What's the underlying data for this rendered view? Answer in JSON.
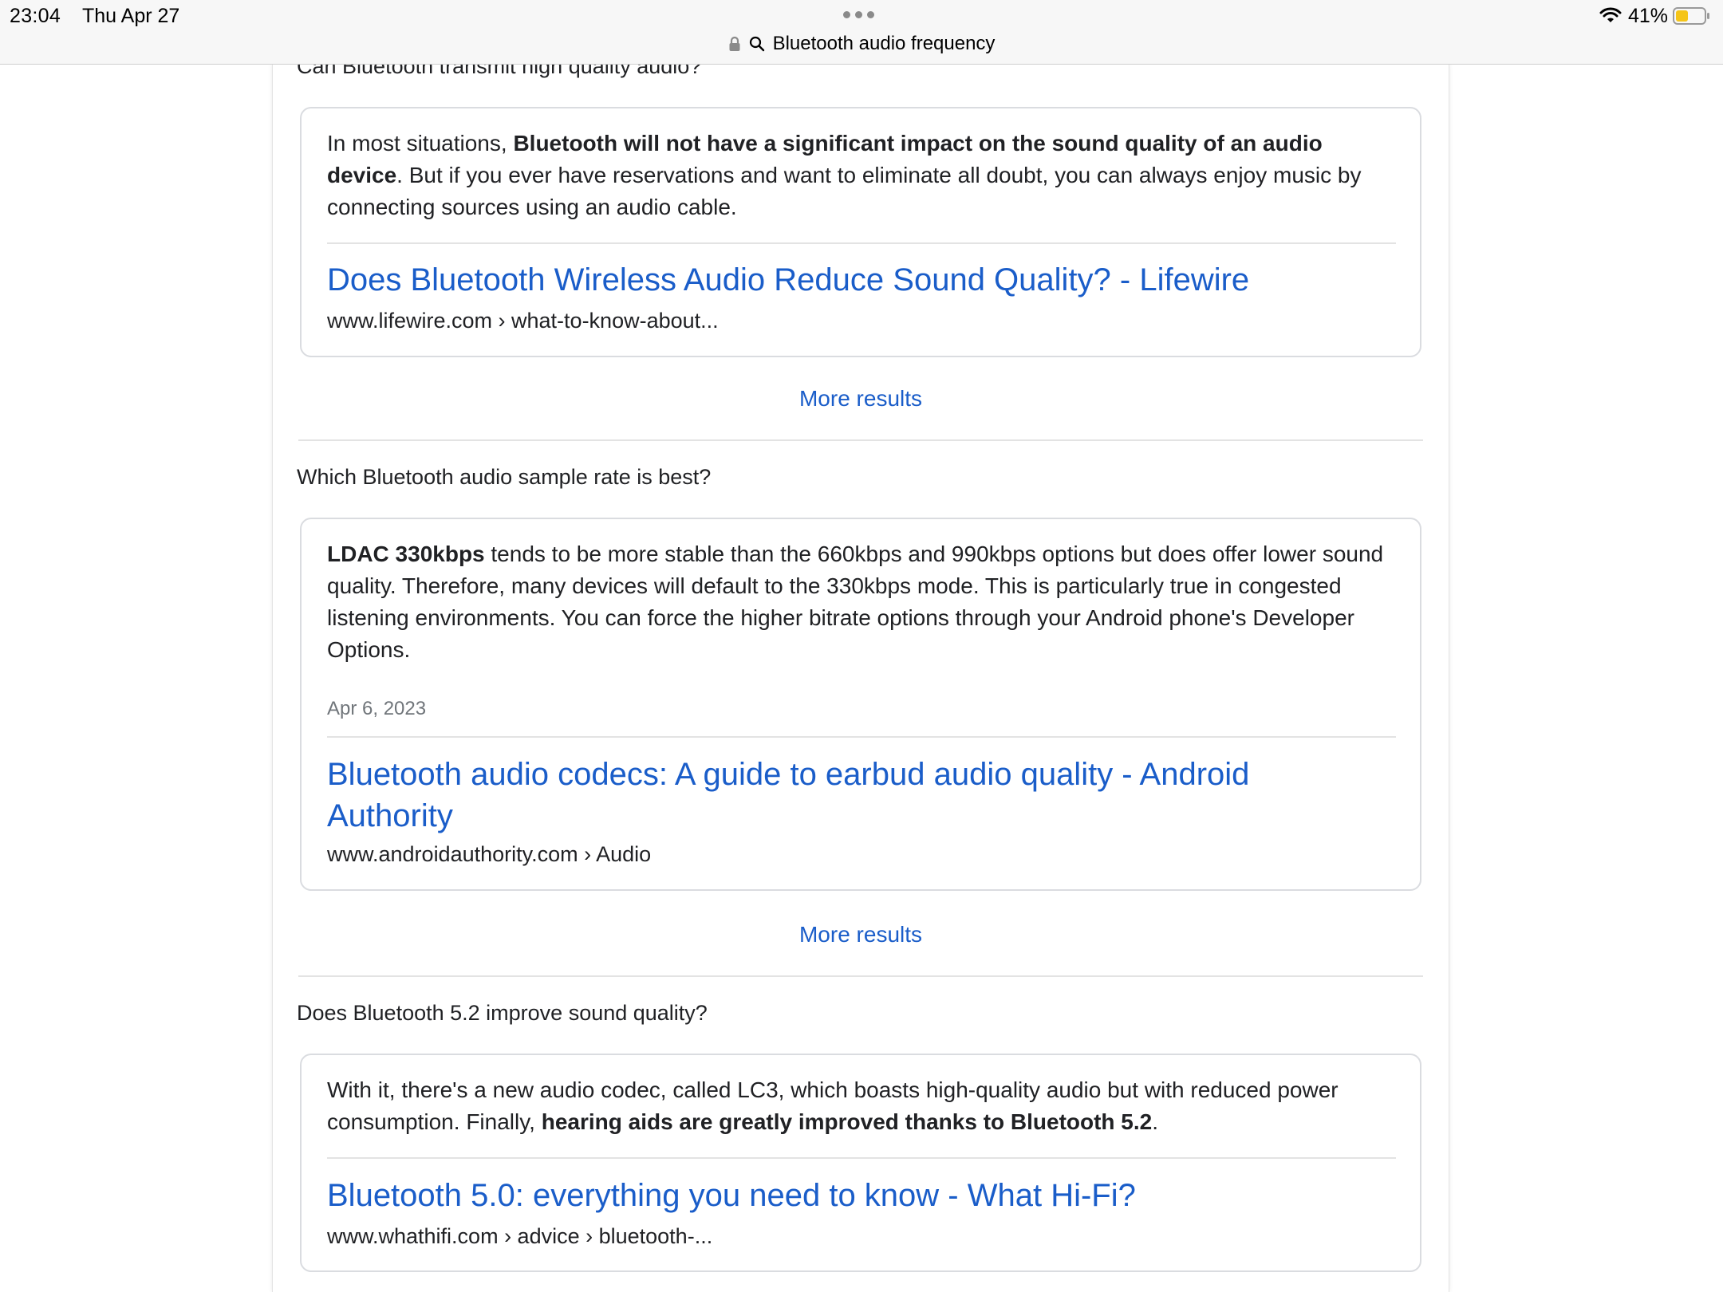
{
  "status": {
    "time": "23:04",
    "date": "Thu Apr 27",
    "battery": "41%"
  },
  "url": {
    "text": "Bluetooth audio frequency"
  },
  "colors": {
    "link": "#1a5dc9",
    "battery_fill": "#f5c518"
  },
  "icons": [
    "lock-icon",
    "search-icon",
    "wifi-icon",
    "battery-icon",
    "more-dots-icon"
  ],
  "sections": [
    {
      "question": "Can Bluetooth transmit high quality audio?",
      "snippet": [
        {
          "t": "In most situations, ",
          "b": false
        },
        {
          "t": "Bluetooth will not have a significant impact on the sound quality of an audio device",
          "b": true
        },
        {
          "t": ". But if you ever have reservations and want to eliminate all doubt, you can always enjoy music by connecting sources using an audio cable.",
          "b": false
        }
      ],
      "date": "",
      "result_title": "Does Bluetooth Wireless Audio Reduce Sound Quality? - Lifewire",
      "result_url": "www.lifewire.com › what-to-know-about...",
      "more": "More results"
    },
    {
      "question": "Which Bluetooth audio sample rate is best?",
      "snippet": [
        {
          "t": "LDAC 330kbps",
          "b": true
        },
        {
          "t": " tends to be more stable than the 660kbps and 990kbps options but does offer lower sound quality. Therefore, many devices will default to the 330kbps mode. This is particularly true in congested listening environments. You can force the higher bitrate options through your Android phone's Developer Options.",
          "b": false
        }
      ],
      "date": "Apr 6, 2023",
      "result_title": "Bluetooth audio codecs: A guide to earbud audio quality - Android Authority",
      "result_url": "www.androidauthority.com › Audio",
      "more": "More results"
    },
    {
      "question": "Does Bluetooth 5.2 improve sound quality?",
      "snippet": [
        {
          "t": "With it, there's a new audio codec, called LC3, which boasts high-quality audio but with reduced power consumption. Finally, ",
          "b": false
        },
        {
          "t": "hearing aids are greatly improved thanks to Bluetooth 5.2",
          "b": true
        },
        {
          "t": ".",
          "b": false
        }
      ],
      "date": "",
      "result_title": "Bluetooth 5.0: everything you need to know - What Hi-Fi?",
      "result_url": "www.whathifi.com › advice › bluetooth-...",
      "more": ""
    }
  ]
}
